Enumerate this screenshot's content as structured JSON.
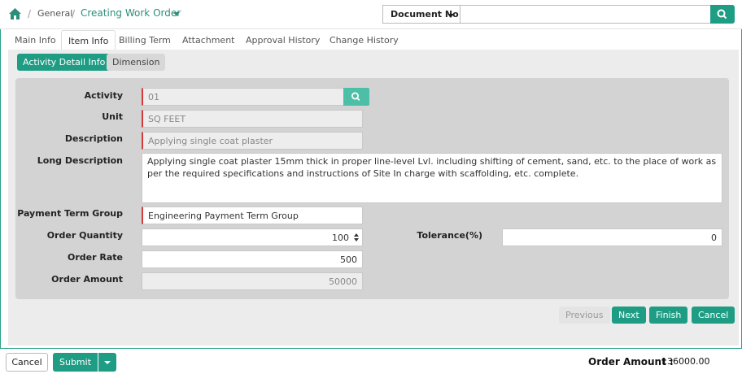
{
  "breadcrumb": {
    "home_icon": "home-icon",
    "separator": "/",
    "section": "General",
    "current": "Creating Work Order"
  },
  "search": {
    "doc_type": "Document No",
    "value": "",
    "icon": "search-icon"
  },
  "tabs": [
    {
      "label": "Main Info",
      "active": false
    },
    {
      "label": "Item Info",
      "active": true
    },
    {
      "label": "Billing Term",
      "active": false
    },
    {
      "label": "Attachment",
      "active": false
    },
    {
      "label": "Approval History",
      "active": false
    },
    {
      "label": "Change History",
      "active": false
    }
  ],
  "subtabs": [
    {
      "label": "Activity Detail Info",
      "active": true
    },
    {
      "label": "Dimension",
      "active": false
    }
  ],
  "form": {
    "activity": {
      "label": "Activity",
      "value": "01"
    },
    "unit": {
      "label": "Unit",
      "value": "SQ FEET"
    },
    "description": {
      "label": "Description",
      "value": "Applying single coat plaster"
    },
    "long_description": {
      "label": "Long Description",
      "value": "Applying single coat plaster 15mm thick in proper line-level  Lvl. including shifting of cement, sand, etc. to the place of work as per the required specifications and instructions of Site In charge with scaffolding, etc. complete."
    },
    "payment_term_group": {
      "label": "Payment Term Group",
      "value": "Engineering Payment Term Group"
    },
    "order_quantity": {
      "label": "Order Quantity",
      "value": "100"
    },
    "tolerance": {
      "label": "Tolerance(%)",
      "value": "0"
    },
    "order_rate": {
      "label": "Order Rate",
      "value": "500"
    },
    "order_amount": {
      "label": "Order Amount",
      "value": "50000"
    }
  },
  "nav": {
    "previous": "Previous",
    "next": "Next",
    "finish": "Finish",
    "cancel": "Cancel"
  },
  "footer": {
    "cancel": "Cancel",
    "submit": "Submit",
    "total_label": "Order Amount :",
    "total_value": "136000.00"
  },
  "colors": {
    "accent": "#1f9d84",
    "required": "#d43a3a"
  }
}
